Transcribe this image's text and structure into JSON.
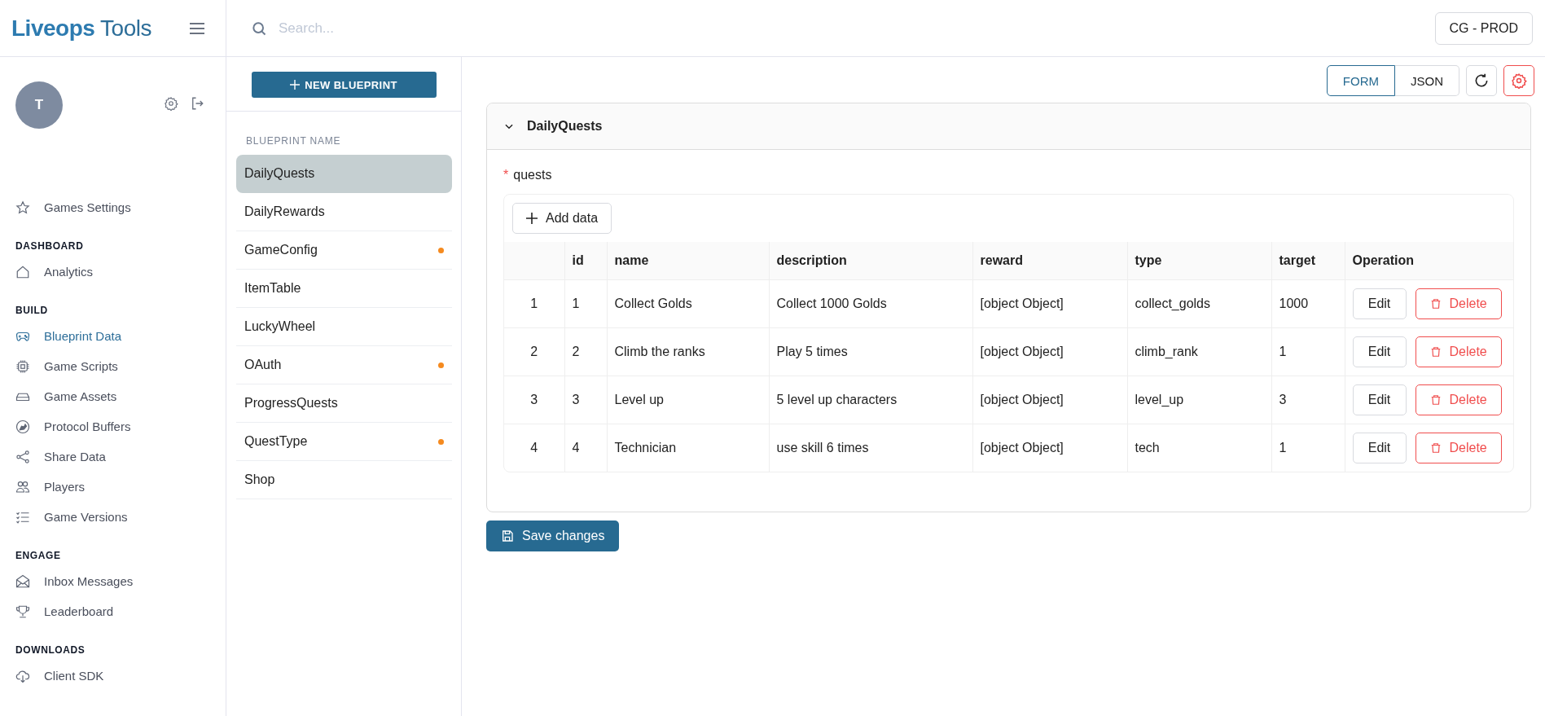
{
  "app": {
    "logo_bold": "Liveops",
    "logo_light": "Tools"
  },
  "search": {
    "placeholder": "Search..."
  },
  "environment_button": "CG - PROD",
  "user": {
    "avatar_initial": "T"
  },
  "nav_top": {
    "label": "Games Settings",
    "selected": false
  },
  "nav_sections": [
    {
      "title": "DASHBOARD",
      "items": [
        {
          "label": "Analytics",
          "selected": false
        }
      ]
    },
    {
      "title": "BUILD",
      "items": [
        {
          "label": "Blueprint Data",
          "selected": true
        },
        {
          "label": "Game Scripts",
          "selected": false
        },
        {
          "label": "Game Assets",
          "selected": false
        },
        {
          "label": "Protocol Buffers",
          "selected": false
        },
        {
          "label": "Share Data",
          "selected": false
        },
        {
          "label": "Players",
          "selected": false
        },
        {
          "label": "Game Versions",
          "selected": false
        }
      ]
    },
    {
      "title": "ENGAGE",
      "items": [
        {
          "label": "Inbox Messages",
          "selected": false
        },
        {
          "label": "Leaderboard",
          "selected": false
        }
      ]
    },
    {
      "title": "DOWNLOADS",
      "items": [
        {
          "label": "Client SDK",
          "selected": false
        }
      ]
    }
  ],
  "blueprints": {
    "new_button": "NEW BLUEPRINT",
    "header": "BLUEPRINT NAME",
    "items": [
      {
        "name": "DailyQuests",
        "selected": true,
        "modified": false
      },
      {
        "name": "DailyRewards",
        "selected": false,
        "modified": false
      },
      {
        "name": "GameConfig",
        "selected": false,
        "modified": true
      },
      {
        "name": "ItemTable",
        "selected": false,
        "modified": false
      },
      {
        "name": "LuckyWheel",
        "selected": false,
        "modified": false
      },
      {
        "name": "OAuth",
        "selected": false,
        "modified": true
      },
      {
        "name": "ProgressQuests",
        "selected": false,
        "modified": false
      },
      {
        "name": "QuestType",
        "selected": false,
        "modified": true
      },
      {
        "name": "Shop",
        "selected": false,
        "modified": false
      }
    ]
  },
  "view_tabs": [
    {
      "label": "FORM",
      "selected": true
    },
    {
      "label": "JSON",
      "selected": false
    }
  ],
  "panel": {
    "title": "DailyQuests",
    "expanded": true,
    "field": {
      "required_mark": "*",
      "label": "quests"
    },
    "add_button": "Add data",
    "columns": [
      "id",
      "name",
      "description",
      "reward",
      "type",
      "target",
      "Operation"
    ],
    "rows": [
      {
        "index": "1",
        "cells": [
          "1",
          "Collect Golds",
          "Collect 1000 Golds",
          "[object Object]",
          "collect_golds",
          "1000"
        ],
        "edit": "Edit",
        "delete": "Delete"
      },
      {
        "index": "2",
        "cells": [
          "2",
          "Climb the ranks",
          "Play 5 times",
          "[object Object]",
          "climb_rank",
          "1"
        ],
        "edit": "Edit",
        "delete": "Delete"
      },
      {
        "index": "3",
        "cells": [
          "3",
          "Level up",
          "5 level up characters",
          "[object Object]",
          "level_up",
          "3"
        ],
        "edit": "Edit",
        "delete": "Delete"
      },
      {
        "index": "4",
        "cells": [
          "4",
          "Technician",
          "use skill 6 times",
          "[object Object]",
          "tech",
          "1"
        ],
        "edit": "Edit",
        "delete": "Delete"
      }
    ]
  },
  "save_button": "Save changes"
}
